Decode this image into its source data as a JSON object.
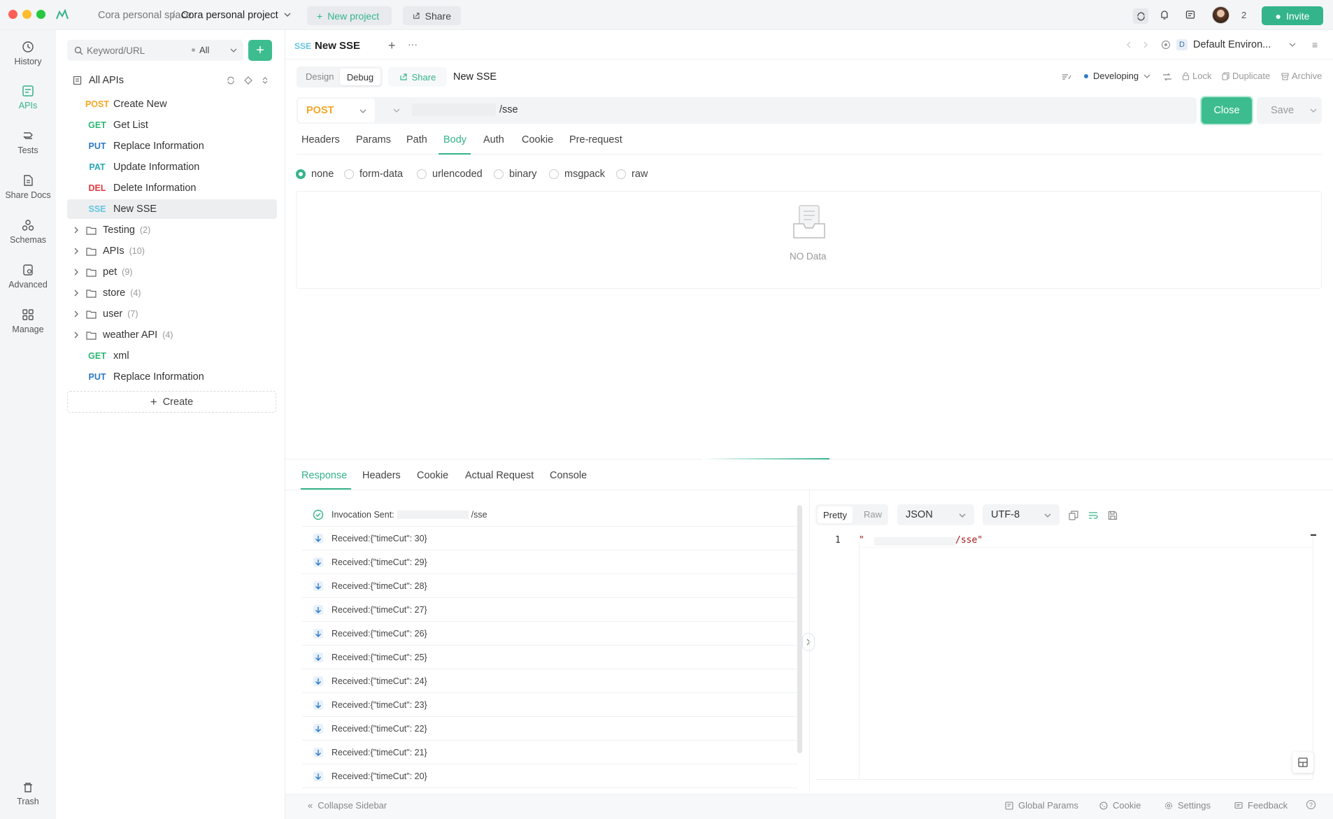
{
  "titlebar": {
    "workspace": "Cora personal space",
    "separator": "/",
    "project": "Cora personal project",
    "new_project": "New project",
    "share": "Share",
    "member_count": "2",
    "invite": "Invite"
  },
  "rail": {
    "items": [
      {
        "label": "History",
        "icon": "history-icon"
      },
      {
        "label": "APIs",
        "icon": "apis-icon"
      },
      {
        "label": "Tests",
        "icon": "tests-icon"
      },
      {
        "label": "Share Docs",
        "icon": "share-docs-icon"
      },
      {
        "label": "Schemas",
        "icon": "schemas-icon"
      },
      {
        "label": "Advanced",
        "icon": "advanced-icon"
      },
      {
        "label": "Manage",
        "icon": "manage-icon"
      }
    ],
    "trash": "Trash"
  },
  "sidebar": {
    "search_placeholder": "Keyword/URL",
    "filter": "All",
    "section_title": "All APIs",
    "endpoints": [
      {
        "method": "POST",
        "name": "Create New"
      },
      {
        "method": "GET",
        "name": "Get List"
      },
      {
        "method": "PUT",
        "name": "Replace Information"
      },
      {
        "method": "PAT",
        "name": "Update Information"
      },
      {
        "method": "DEL",
        "name": "Delete Information"
      },
      {
        "method": "SSE",
        "name": "New SSE"
      }
    ],
    "folders": [
      {
        "name": "Testing",
        "count": "(2)"
      },
      {
        "name": "APIs",
        "count": "(10)"
      },
      {
        "name": "pet",
        "count": "(9)"
      },
      {
        "name": "store",
        "count": "(4)"
      },
      {
        "name": "user",
        "count": "(7)"
      },
      {
        "name": "weather API",
        "count": "(4)"
      }
    ],
    "extra": [
      {
        "method": "GET",
        "name": "xml"
      },
      {
        "method": "PUT",
        "name": "Replace Information"
      }
    ],
    "create": "Create"
  },
  "editor": {
    "tab_badge": "SSE",
    "tab_title": "New SSE",
    "environment_badge": "D",
    "environment": "Default Environ...",
    "mode_design": "Design",
    "mode_debug": "Debug",
    "share": "Share",
    "api_name": "New SSE",
    "status": "Developing",
    "lock": "Lock",
    "duplicate": "Duplicate",
    "archive": "Archive",
    "method": "POST",
    "url_path": "/sse",
    "close": "Close",
    "save": "Save",
    "request_tabs": [
      "Headers",
      "Params",
      "Path",
      "Body",
      "Auth",
      "Cookie",
      "Pre-request"
    ],
    "body_types": [
      "none",
      "form-data",
      "urlencoded",
      "binary",
      "msgpack",
      "raw"
    ],
    "no_data": "NO Data"
  },
  "response": {
    "tabs": [
      "Response",
      "Headers",
      "Cookie",
      "Actual Request",
      "Console"
    ],
    "invocation_label": "Invocation Sent:",
    "invocation_path": "/sse",
    "events": [
      "Received:{\"timeCut\": 30}",
      "Received:{\"timeCut\": 29}",
      "Received:{\"timeCut\": 28}",
      "Received:{\"timeCut\": 27}",
      "Received:{\"timeCut\": 26}",
      "Received:{\"timeCut\": 25}",
      "Received:{\"timeCut\": 24}",
      "Received:{\"timeCut\": 23}",
      "Received:{\"timeCut\": 22}",
      "Received:{\"timeCut\": 21}",
      "Received:{\"timeCut\": 20}"
    ],
    "view_pretty": "Pretty",
    "view_raw": "Raw",
    "format": "JSON",
    "encoding": "UTF-8",
    "line_number": "1",
    "code_quote": "\"",
    "code_tail": "/sse\""
  },
  "footer": {
    "collapse": "Collapse Sidebar",
    "global_params": "Global Params",
    "cookie": "Cookie",
    "settings": "Settings",
    "feedback": "Feedback"
  },
  "colors": {
    "accent": "#34b48a",
    "post": "#f5a623",
    "get": "#2bb673",
    "put": "#2d7bc4",
    "delete": "#e0393e",
    "sse": "#63c5de"
  }
}
